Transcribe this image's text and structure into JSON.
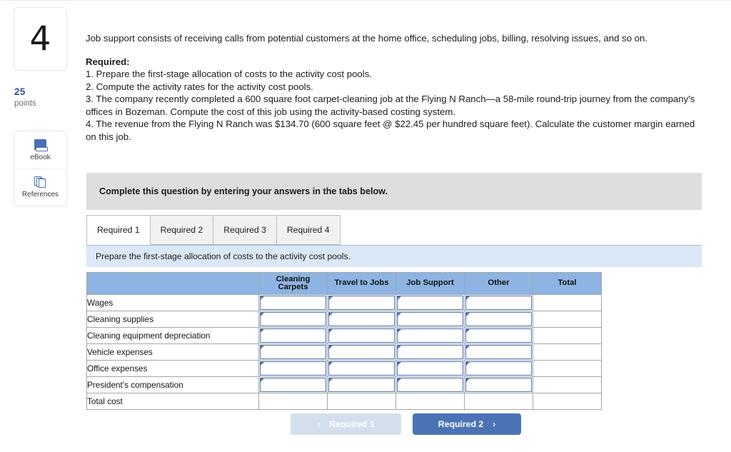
{
  "left_rail": {
    "question_number": "4",
    "points_value": "25",
    "points_label": "points",
    "tools": [
      {
        "icon": "ebook-icon",
        "label": "eBook"
      },
      {
        "icon": "references-icon",
        "label": "References"
      }
    ]
  },
  "question": {
    "intro": "Job support consists of receiving calls from potential customers at the home office, scheduling jobs, billing, resolving issues, and so on.",
    "required_heading": "Required:",
    "requirements": [
      "1. Prepare the first-stage allocation of costs to the activity cost pools.",
      "2. Compute the activity rates for the activity cost pools.",
      "3. The company recently completed a 600 square foot carpet-cleaning job at the Flying N Ranch—a 58-mile round-trip journey from the company's offices in Bozeman. Compute the cost of this job using the activity-based costing system.",
      "4. The revenue from the Flying N Ranch was $134.70 (600 square feet @ $22.45 per hundred square feet). Calculate the customer margin earned on this job."
    ]
  },
  "banner": {
    "text": "Complete this question by entering your answers in the tabs below."
  },
  "tabs": [
    {
      "label": "Required 1",
      "active": true
    },
    {
      "label": "Required 2",
      "active": false
    },
    {
      "label": "Required 3",
      "active": false
    },
    {
      "label": "Required 4",
      "active": false
    }
  ],
  "instruction": {
    "text": "Prepare the first-stage allocation of costs to the activity cost pools."
  },
  "table": {
    "headers": [
      "",
      "Cleaning Carpets",
      "Travel to Jobs",
      "Job Support",
      "Other",
      "Total"
    ],
    "header_cleaning_carpets_line1": "Cleaning",
    "header_cleaning_carpets_line2": "Carpets",
    "rows": [
      {
        "label": "Wages",
        "values": [
          "",
          "",
          "",
          "",
          ""
        ],
        "is_total": false
      },
      {
        "label": "Cleaning supplies",
        "values": [
          "",
          "",
          "",
          "",
          ""
        ],
        "is_total": false
      },
      {
        "label": "Cleaning equipment depreciation",
        "values": [
          "",
          "",
          "",
          "",
          ""
        ],
        "is_total": false
      },
      {
        "label": "Vehicle expenses",
        "values": [
          "",
          "",
          "",
          "",
          ""
        ],
        "is_total": false
      },
      {
        "label": "Office expenses",
        "values": [
          "",
          "",
          "",
          "",
          ""
        ],
        "is_total": false
      },
      {
        "label": "President's compensation",
        "values": [
          "",
          "",
          "",
          "",
          ""
        ],
        "is_total": false
      },
      {
        "label": "Total cost",
        "values": [
          "",
          "",
          "",
          "",
          ""
        ],
        "is_total": true
      }
    ]
  },
  "footer": {
    "prev_label": "Required 1",
    "prev_chevron": "‹",
    "next_label": "Required 2",
    "next_chevron": "›"
  },
  "colors": {
    "table_header_blue": "#8db4e2",
    "instruction_blue": "#dbe8f7",
    "banner_gray": "#dedede",
    "primary_button_blue": "#4a74b5",
    "disabled_button_blue": "#d4dfee",
    "points_blue": "#2f4f8f"
  }
}
